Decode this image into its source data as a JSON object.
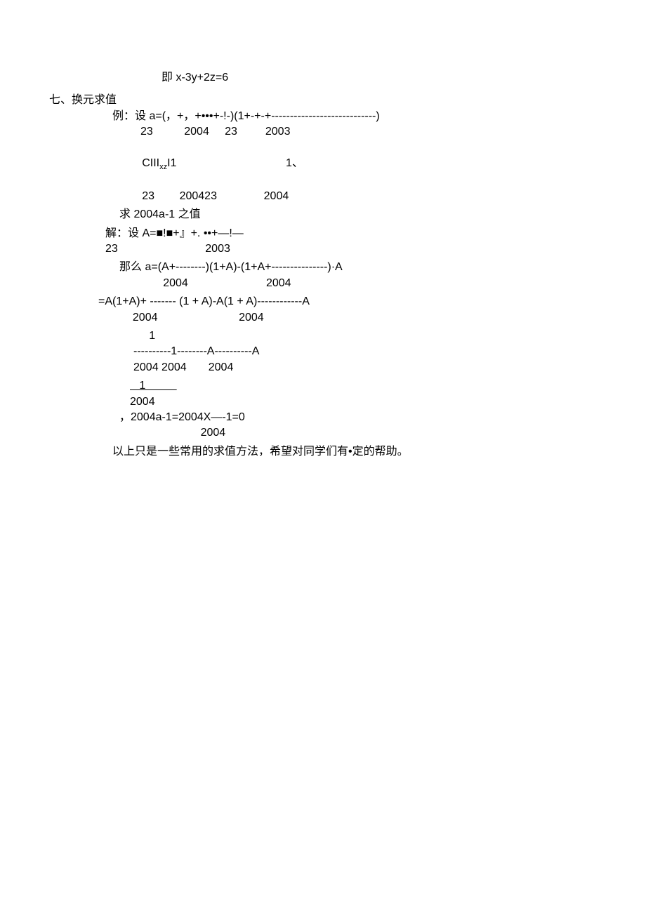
{
  "l1": "即 x-3y+2z=6",
  "l2": "七、换元求值",
  "l3": "例：设 a=(，+，+•••+-!-)(1+-+-+----------------------------)",
  "l4": "         23          2004     23         2003",
  "l5": " CIIIxzI1                                   1、",
  "l6": "     23        200423               2004",
  "l7": "求 2004a-1 之值",
  "l8": "解：设 A=■!■+』+. ••+—!—",
  "l9": "23                            2003",
  "l10": "那么 a=(A+--------)(1+A)-(1+A+---------------)·A",
  "l11": "              2004                         2004",
  "l12": "=A(1+A)+ ------- (1 + A)-A(1 + A)------------A",
  "l13": "           2004                          2004",
  "l14": "     1",
  "l15": "----------1--------A----------A",
  "l16": "2004 2004       2004",
  "l17": "   1          ",
  "l18": "2004",
  "l19": "，2004a-1=2004X—-1=0",
  "l20": "                          2004",
  "l21": "以上只是一些常用的求值方法，希望对同学们有•定的帮助。"
}
